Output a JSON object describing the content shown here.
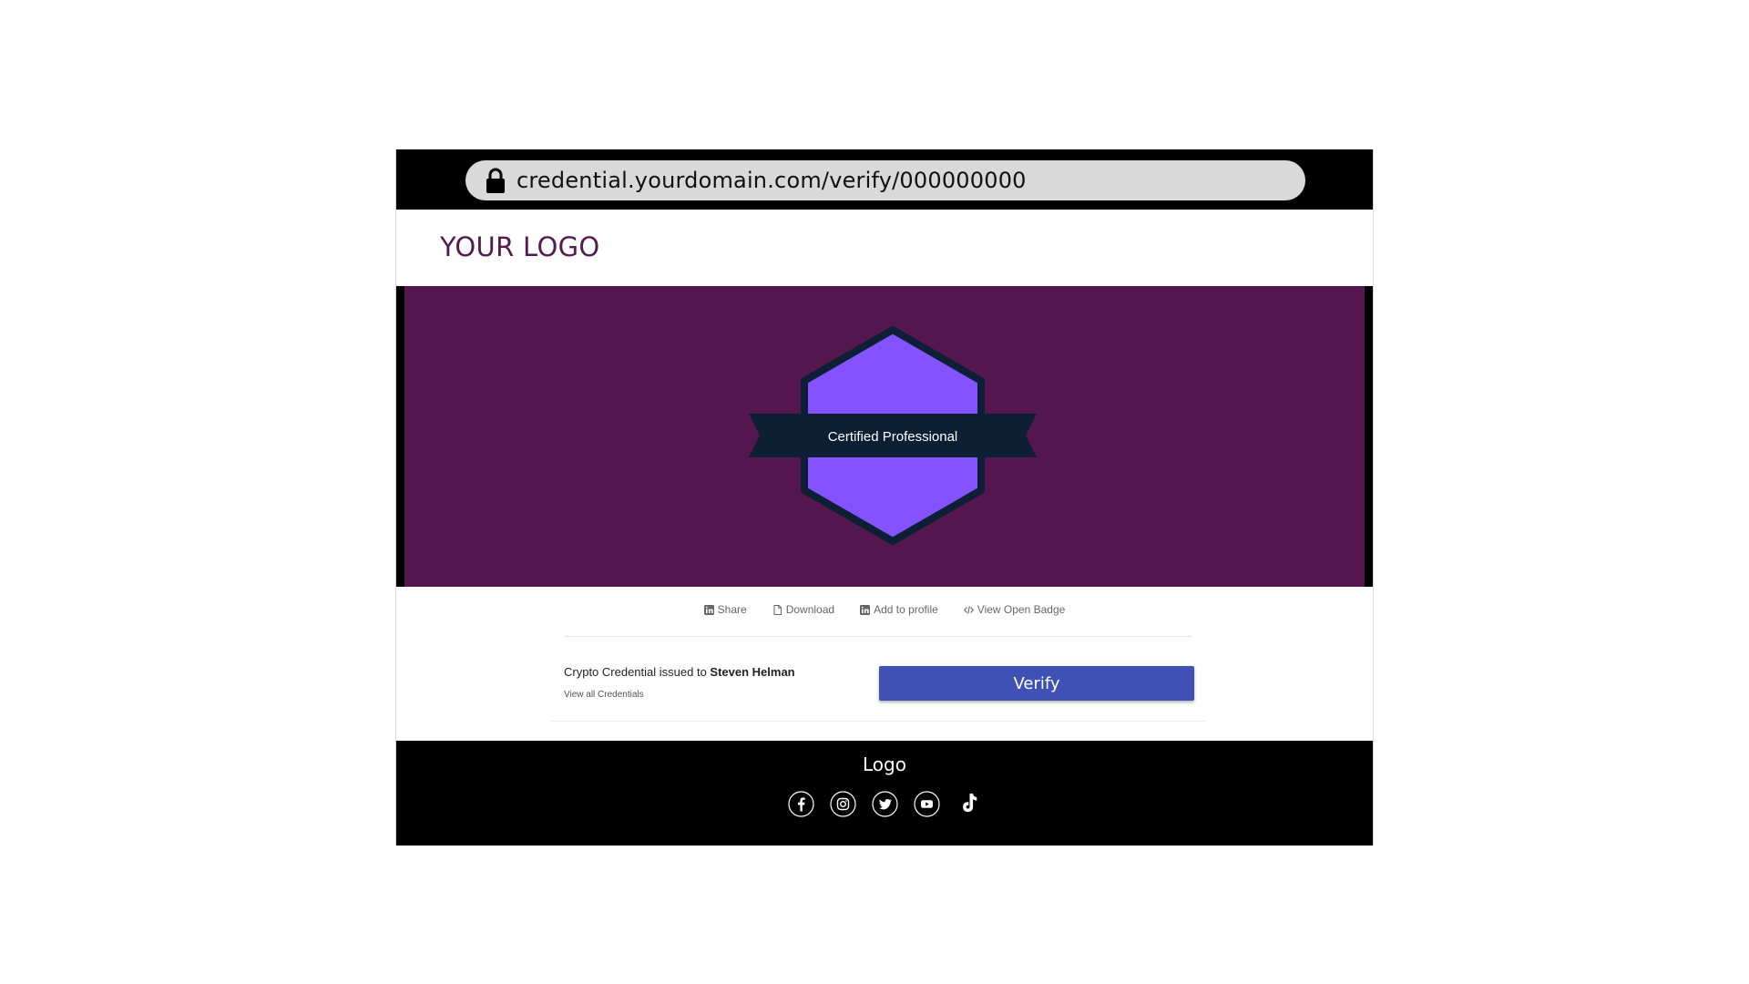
{
  "browser": {
    "url": "credential.yourdomain.com/verify/000000000"
  },
  "header": {
    "logo_text": "YOUR LOGO"
  },
  "badge": {
    "ribbon_text": "Certified Professional",
    "colors": {
      "hero_bg": "#541750",
      "hexagon_fill": "#8452ff",
      "hexagon_border": "#0c1f35",
      "ribbon": "#0c1f35"
    }
  },
  "actions": [
    {
      "label": "Share",
      "icon": "linkedin-icon"
    },
    {
      "label": "Download",
      "icon": "file-icon"
    },
    {
      "label": "Add to profile",
      "icon": "linkedin-icon"
    },
    {
      "label": "View Open Badge",
      "icon": "code-icon"
    }
  ],
  "credential": {
    "issued_prefix": "Crypto Credential issued to ",
    "recipient_name": "Steven Helman",
    "view_all_label": "View all Credentials"
  },
  "verify": {
    "label": "Verify",
    "color": "#3f51b5"
  },
  "footer": {
    "logo_text": "Logo",
    "socials": [
      "facebook-icon",
      "instagram-icon",
      "twitter-icon",
      "youtube-icon",
      "tiktok-icon"
    ]
  }
}
